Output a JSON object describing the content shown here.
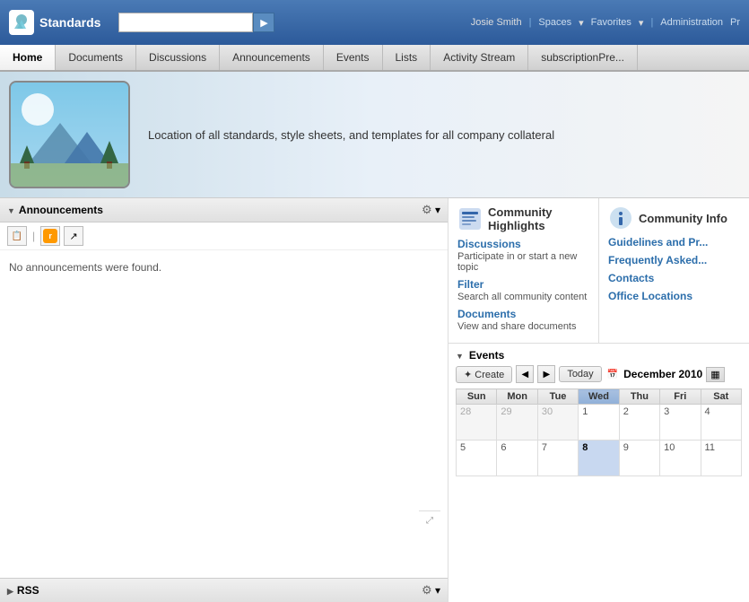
{
  "app": {
    "logo_text": "Standards",
    "search_placeholder": ""
  },
  "topbar": {
    "user": "Josie Smith",
    "spaces_label": "Spaces",
    "favorites_label": "Favorites",
    "admin_label": "Administration",
    "pr_label": "Pr"
  },
  "nav": {
    "items": [
      {
        "label": "Home",
        "active": true
      },
      {
        "label": "Documents",
        "active": false
      },
      {
        "label": "Discussions",
        "active": false
      },
      {
        "label": "Announcements",
        "active": false
      },
      {
        "label": "Events",
        "active": false
      },
      {
        "label": "Lists",
        "active": false
      },
      {
        "label": "Activity Stream",
        "active": false
      },
      {
        "label": "subscriptionPre...",
        "active": false
      }
    ]
  },
  "banner": {
    "description": "Location of all standards, style sheets, and templates for all company collateral"
  },
  "announcements": {
    "title": "Announcements",
    "no_items_text": "No announcements were found.",
    "toolbar": {
      "add_icon": "📋",
      "rss_icon": "RSS",
      "share_icon": "↗"
    }
  },
  "rss": {
    "title": "RSS"
  },
  "community_highlights": {
    "title": "Community Highlights",
    "items": [
      {
        "link": "Discussions",
        "desc": "Participate in or start a new topic"
      },
      {
        "link": "Filter",
        "desc": "Search all community content"
      },
      {
        "link": "Documents",
        "desc": "View and share documents"
      }
    ]
  },
  "community_info": {
    "title": "Community Info",
    "items": [
      {
        "link": "Guidelines and Pr..."
      },
      {
        "link": "Frequently Asked..."
      },
      {
        "link": "Contacts"
      },
      {
        "link": "Office Locations"
      }
    ]
  },
  "events": {
    "title": "Events",
    "create_label": "Create",
    "today_label": "Today",
    "month_label": "December 2010",
    "calendar": {
      "headers": [
        "Sun",
        "Mon",
        "Tue",
        "Wed",
        "Thu",
        "Fri",
        "Sat"
      ],
      "weeks": [
        [
          {
            "day": 28,
            "type": "other"
          },
          {
            "day": 29,
            "type": "other"
          },
          {
            "day": 30,
            "type": "other"
          },
          {
            "day": 1,
            "type": "current"
          },
          {
            "day": 2,
            "type": "current"
          },
          {
            "day": 3,
            "type": "current"
          },
          {
            "day": 4,
            "type": "current"
          }
        ],
        [
          {
            "day": 5,
            "type": "current"
          },
          {
            "day": 6,
            "type": "current"
          },
          {
            "day": 7,
            "type": "current"
          },
          {
            "day": 8,
            "type": "today"
          },
          {
            "day": 9,
            "type": "current"
          },
          {
            "day": 10,
            "type": "current"
          },
          {
            "day": 11,
            "type": "current"
          }
        ]
      ]
    }
  }
}
